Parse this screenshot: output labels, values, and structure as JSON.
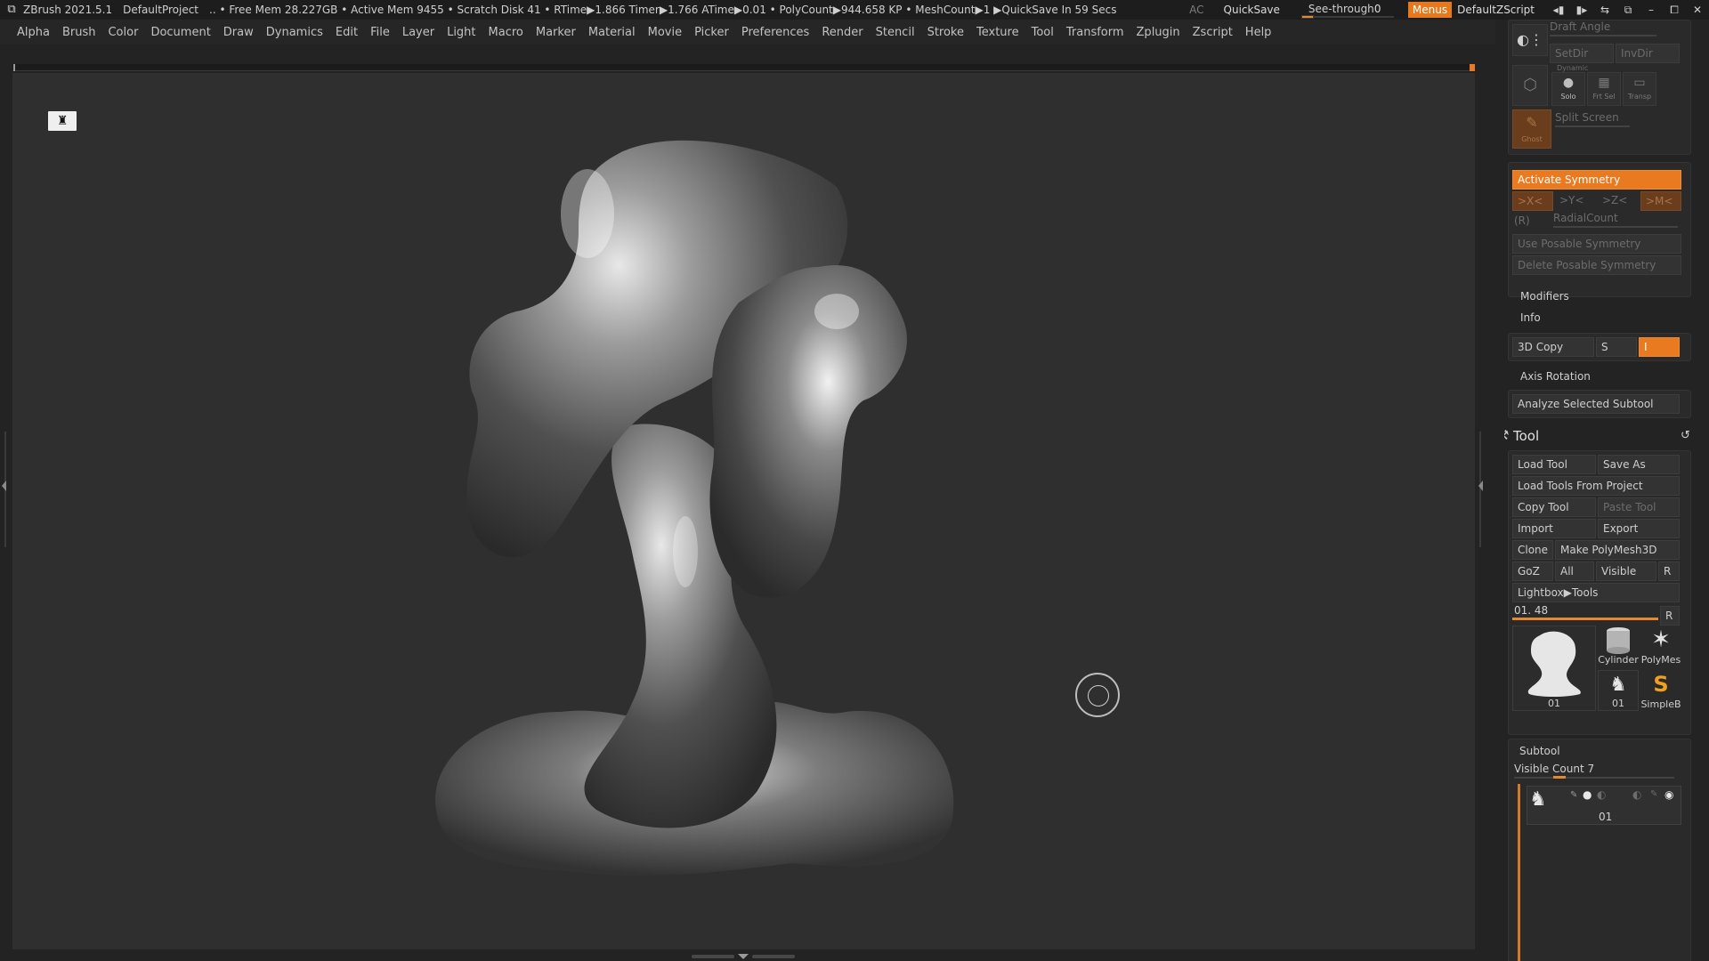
{
  "titlebar": {
    "app": "ZBrush 2021.5.1",
    "project": "DefaultProject",
    "status": ".. • Free Mem 28.227GB • Active Mem 9455 • Scratch Disk 41 •  RTime▶1.866 Timer▶1.766 ATime▶0.01 • PolyCount▶944.658 KP  • MeshCount▶1  ▶QuickSave In 59 Secs",
    "ac": "AC",
    "quicksave": "QuickSave",
    "see_through_label": "See-through",
    "see_through_value": "0",
    "see_through_fraction": 0.0,
    "menus": "Menus",
    "zscript": "DefaultZScript",
    "accent": "#e8781e"
  },
  "menubar": {
    "items": [
      "Alpha",
      "Brush",
      "Color",
      "Document",
      "Draw",
      "Dynamics",
      "Edit",
      "File",
      "Layer",
      "Light",
      "Macro",
      "Marker",
      "Material",
      "Movie",
      "Picker",
      "Preferences",
      "Render",
      "Stencil",
      "Stroke",
      "Texture",
      "Tool",
      "Transform",
      "Zplugin",
      "Zscript",
      "Help"
    ]
  },
  "canvas": {
    "perspective_icon": "figure-icon",
    "background": "#2f2f2f"
  },
  "rightpanel": {
    "draft_angle": "Draft Angle",
    "setdir": "SetDir",
    "invdir": "InvDir",
    "dynamic": "Dynamic",
    "solo": "Solo",
    "frt_sel": "Frt Sel",
    "transp": "Transp",
    "ghost": "Ghost",
    "split_screen": "Split Screen",
    "activate_symmetry": "Activate Symmetry",
    "sym_x": ">X<",
    "sym_y": ">Y<",
    "sym_z": ">Z<",
    "sym_m": ">M<",
    "sym_r": "(R)",
    "radialcount": "RadialCount",
    "use_posable": "Use Posable Symmetry",
    "delete_posable": "Delete Posable Symmetry",
    "modifiers": "Modifiers",
    "info": "Info",
    "copy3d": "3D Copy",
    "copy3d_s": "S",
    "copy3d_i": "I",
    "axis_rotation": "Axis Rotation",
    "analyze": "Analyze Selected Subtool",
    "tool_title": "Tool",
    "load_tool": "Load Tool",
    "save_as": "Save As",
    "load_from_project": "Load Tools From Project",
    "copy_tool": "Copy Tool",
    "paste_tool": "Paste Tool",
    "import": "Import",
    "export": "Export",
    "clone": "Clone",
    "make_polymesh": "Make PolyMesh3D",
    "goz": "GoZ",
    "all": "All",
    "visible": "Visible",
    "r": "R",
    "lightbox_tools": "Lightbox▶Tools",
    "tool_name": "01. 48",
    "tool_slider_fraction": 1.0,
    "thumbs": [
      {
        "label": "01",
        "icon": "sculpt-thumb-icon"
      },
      {
        "label": "Cylinder",
        "icon": "cylinder-icon"
      },
      {
        "label": "PolyMes",
        "icon": "star-icon"
      },
      {
        "label": "01",
        "icon": "sculpt-thumb-small-icon"
      },
      {
        "label": "SimpleB",
        "icon": "simplebrush-icon"
      }
    ],
    "subtool": "Subtool",
    "visible_count": "Visible Count 7",
    "subtool_item": "01"
  }
}
